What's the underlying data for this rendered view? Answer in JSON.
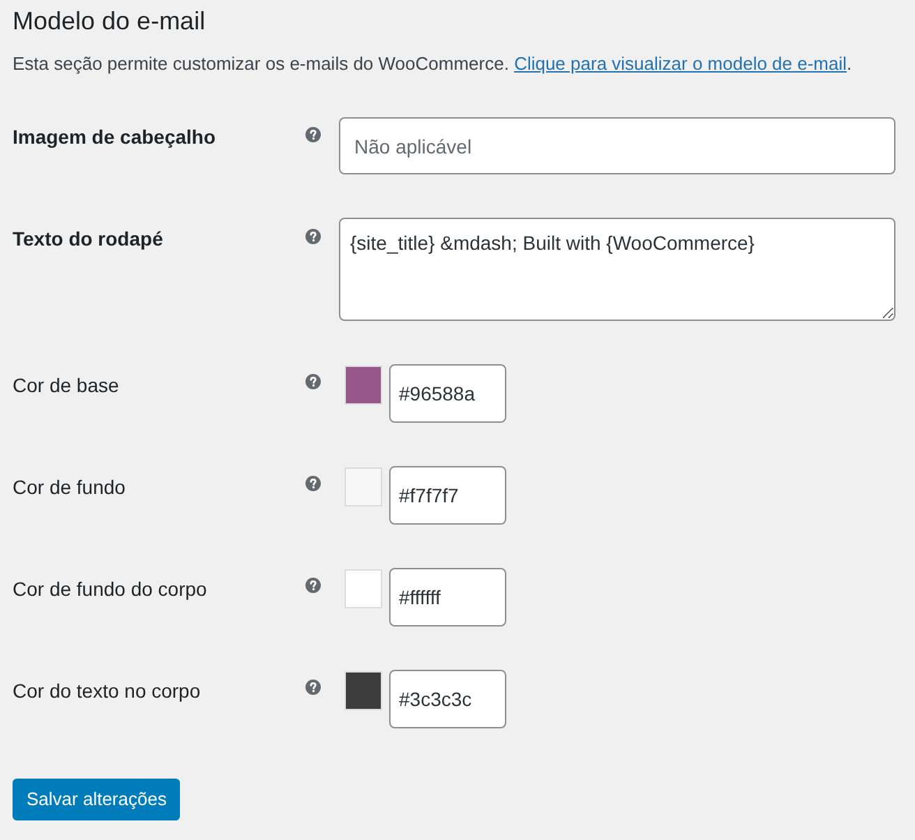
{
  "section": {
    "title": "Modelo do e-mail",
    "description": "Esta seção permite customizar os e-mails do WooCommerce.",
    "link": "Clique para visualizar o modelo de e-mail",
    "after_link": "."
  },
  "fields": [
    {
      "kind": "text",
      "label": "Imagem de cabeçalho",
      "placeholder": "Não aplicável"
    },
    {
      "kind": "textarea",
      "label": "Texto do rodapé",
      "value": "{site_title} &mdash; Built with {WooCommerce}"
    },
    {
      "kind": "color",
      "label": "Cor de base",
      "color": "#96588a",
      "value": "#96588a"
    },
    {
      "kind": "color",
      "label": "Cor de fundo",
      "color": "#f7f7f7",
      "value": "#f7f7f7"
    },
    {
      "kind": "color",
      "label": "Cor de fundo do corpo",
      "color": "#ffffff",
      "value": "#ffffff"
    },
    {
      "kind": "color",
      "label": "Cor do texto no corpo",
      "color": "#3c3c3c",
      "value": "#3c3c3c"
    }
  ],
  "save_button": "Salvar alterações"
}
